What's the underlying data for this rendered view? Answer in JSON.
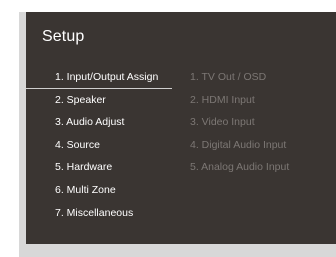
{
  "screen": {
    "title": "Setup"
  },
  "main_menu": {
    "selected_index": 0,
    "items": [
      {
        "label": "1. Input/Output Assign"
      },
      {
        "label": "2. Speaker"
      },
      {
        "label": "3. Audio Adjust"
      },
      {
        "label": "4. Source"
      },
      {
        "label": "5. Hardware"
      },
      {
        "label": "6. Multi Zone"
      },
      {
        "label": "7. Miscellaneous"
      }
    ]
  },
  "sub_menu": {
    "items": [
      {
        "label": "1. TV Out / OSD"
      },
      {
        "label": "2. HDMI Input"
      },
      {
        "label": "3. Video Input"
      },
      {
        "label": "4. Digital Audio Input"
      },
      {
        "label": "5. Analog Audio Input"
      }
    ]
  },
  "colors": {
    "screen_background": "#3a3532",
    "frame_background": "#d8d8d8",
    "active_text": "#ffffff",
    "inactive_text": "#7c7774",
    "selection_line": "#cfcfcf"
  }
}
